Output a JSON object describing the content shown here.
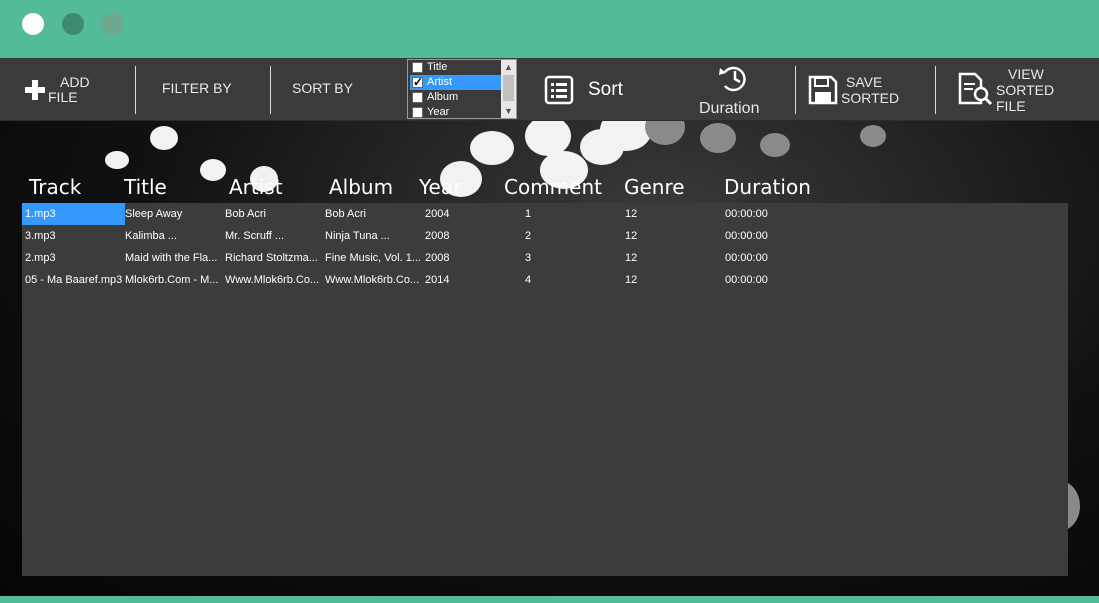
{
  "window": {
    "controls": [
      "close",
      "minimize",
      "maximize"
    ]
  },
  "toolbar": {
    "add_file_line1": "ADD",
    "add_file_line2": "FILE",
    "filter_by": "FILTER BY",
    "sort_by": "SORT BY",
    "sort_fields": [
      {
        "label": "Title",
        "checked": false
      },
      {
        "label": "Artist",
        "checked": true
      },
      {
        "label": "Album",
        "checked": false
      },
      {
        "label": "Year",
        "checked": false
      }
    ],
    "sort_label": "Sort",
    "duration_label": "Duration",
    "save_line1": "SAVE",
    "save_line2": "SORTED",
    "view_line1": "VIEW",
    "view_line2": "SORTED",
    "view_line3": "FILE"
  },
  "columns": [
    "Track",
    "Title",
    "Artist",
    "Album",
    "Year",
    "Comment",
    "Genre",
    "Duration"
  ],
  "rows": [
    [
      "1.mp3",
      "Sleep Away",
      "Bob Acri",
      "Bob Acri",
      "2004",
      "1",
      "12",
      "00:00:00"
    ],
    [
      "3.mp3",
      "Kalimba            ...",
      "Mr. Scruff            ...",
      "Ninja Tuna          ...",
      "2008",
      "2",
      "12",
      "00:00:00"
    ],
    [
      "2.mp3",
      "Maid with the Fla...",
      "Richard Stoltzma...",
      "Fine Music, Vol. 1...",
      "2008",
      "3",
      "12",
      "00:00:00"
    ],
    [
      "05 - Ma Baaref.mp3",
      "Mlok6rb.Com - M...",
      "Www.Mlok6rb.Co...",
      "Www.Mlok6rb.Co...",
      "2014",
      "4",
      "12",
      "00:00:00"
    ]
  ],
  "colors": {
    "accent": "#53bb98",
    "selection": "#3399ff",
    "toolbar": "#3b3b3b",
    "grid": "#3c3c3c"
  }
}
